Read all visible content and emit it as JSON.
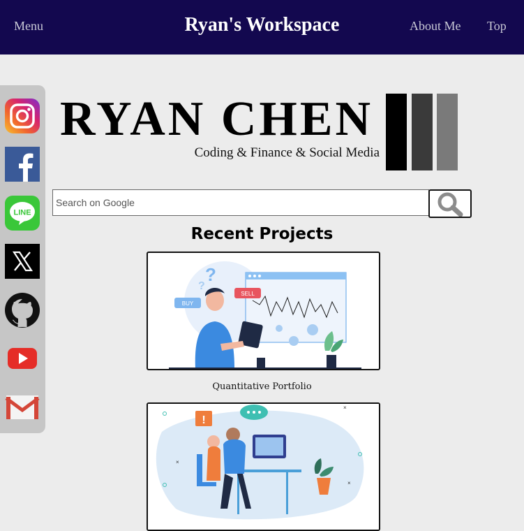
{
  "header": {
    "menu_label": "Menu",
    "title": "Ryan's Workspace",
    "about_label": "About Me",
    "top_label": "Top",
    "background_color": "#13084f"
  },
  "social": [
    {
      "name": "instagram",
      "icon": "instagram-icon"
    },
    {
      "name": "facebook",
      "icon": "facebook-icon"
    },
    {
      "name": "line",
      "icon": "line-icon",
      "text": "LINE"
    },
    {
      "name": "x",
      "icon": "x-icon"
    },
    {
      "name": "github",
      "icon": "github-icon"
    },
    {
      "name": "youtube",
      "icon": "youtube-icon"
    },
    {
      "name": "gmail",
      "icon": "gmail-icon"
    }
  ],
  "logo": {
    "name": "RYAN CHEN",
    "tagline": "Coding & Finance & Social Media"
  },
  "search": {
    "placeholder": "Search on Google",
    "button_icon": "magnifier-icon"
  },
  "projects": {
    "title": "Recent Projects",
    "items": [
      {
        "caption": "Quantitative Portfolio",
        "illustration": {
          "buy_label": "BUY",
          "sell_label": "SELL"
        }
      },
      {
        "caption": "",
        "illustration": {}
      }
    ]
  }
}
